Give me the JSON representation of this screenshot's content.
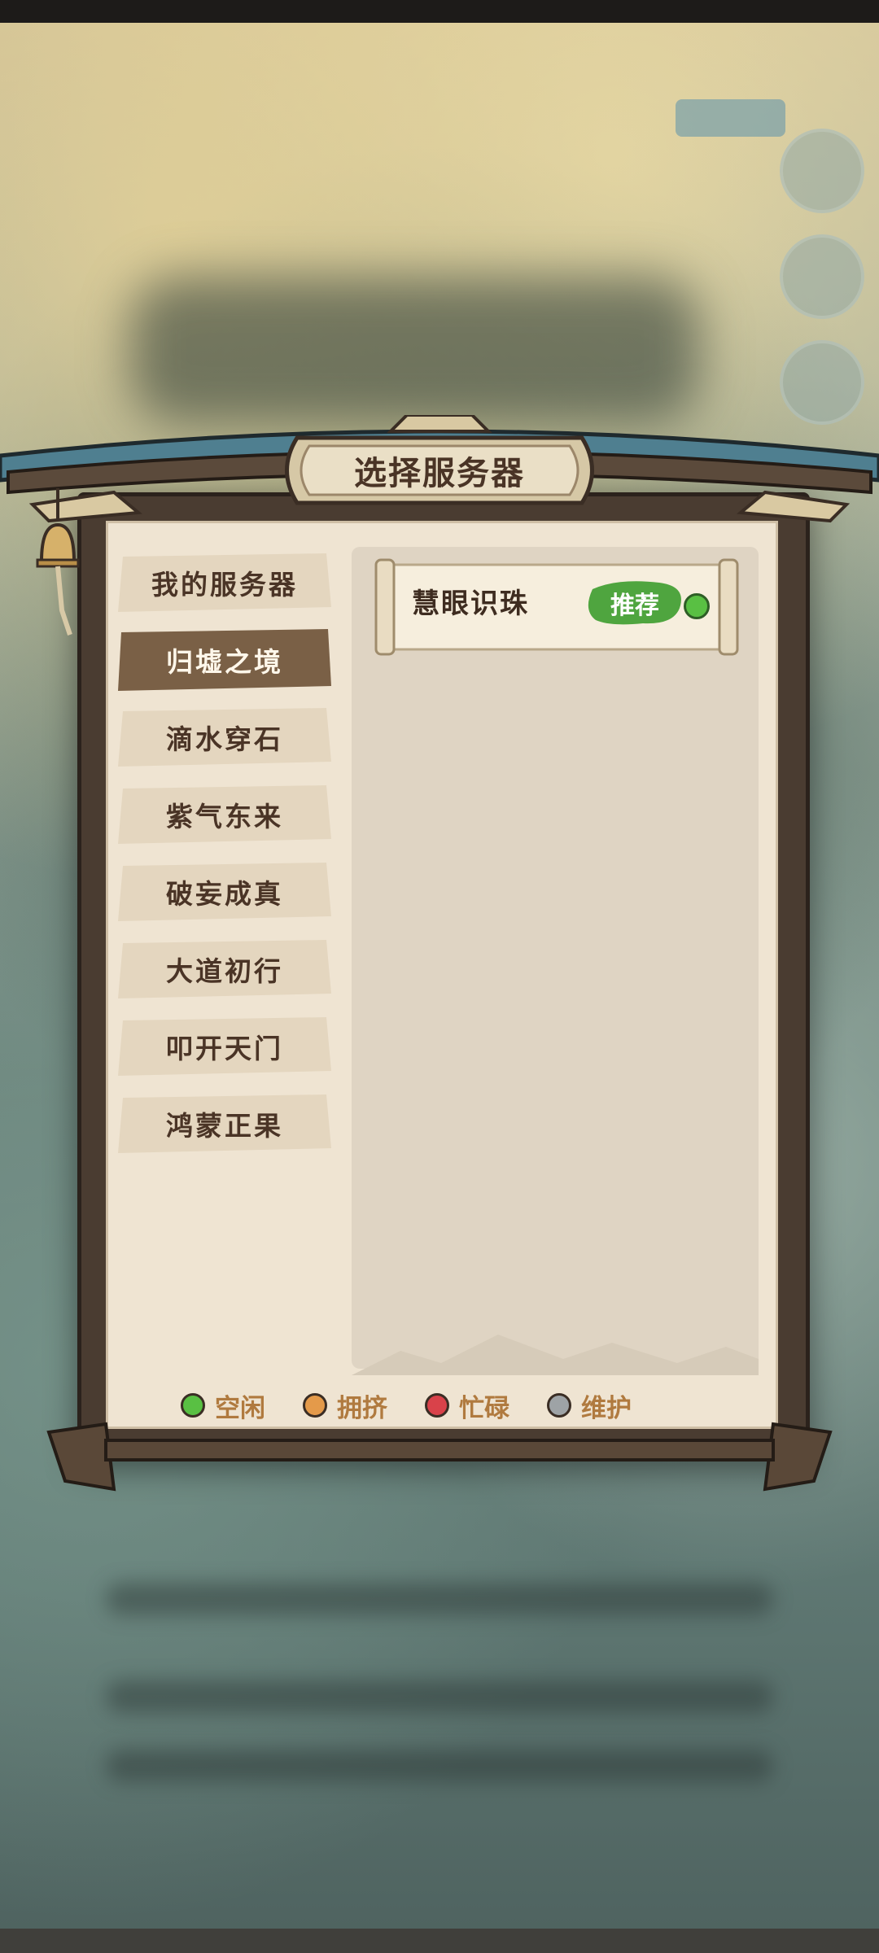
{
  "dialog": {
    "title": "选择服务器"
  },
  "sidebar": {
    "items": [
      {
        "label": "我的服务器",
        "active": false
      },
      {
        "label": "归墟之境",
        "active": true
      },
      {
        "label": "滴水穿石",
        "active": false
      },
      {
        "label": "紫气东来",
        "active": false
      },
      {
        "label": "破妄成真",
        "active": false
      },
      {
        "label": "大道初行",
        "active": false
      },
      {
        "label": "叩开天门",
        "active": false
      },
      {
        "label": "鸿蒙正果",
        "active": false
      }
    ]
  },
  "servers": [
    {
      "name": "慧眼识珠",
      "badge": "推荐",
      "status": "idle",
      "status_color": "#59c043"
    }
  ],
  "legend": [
    {
      "label": "空闲",
      "color": "#59c043",
      "icon": "status-idle-dot"
    },
    {
      "label": "拥挤",
      "color": "#e49a4a",
      "icon": "status-busy-dot"
    },
    {
      "label": "忙碌",
      "color": "#d9424a",
      "icon": "status-full-dot"
    },
    {
      "label": "维护",
      "color": "#9ea3a6",
      "icon": "status-maintenance-dot"
    }
  ],
  "colors": {
    "active_tab": "#7a6046",
    "inactive_tab": "#e6dac6",
    "recommend_badge": "#4fa53f",
    "legend_text": "#b07a3f"
  }
}
